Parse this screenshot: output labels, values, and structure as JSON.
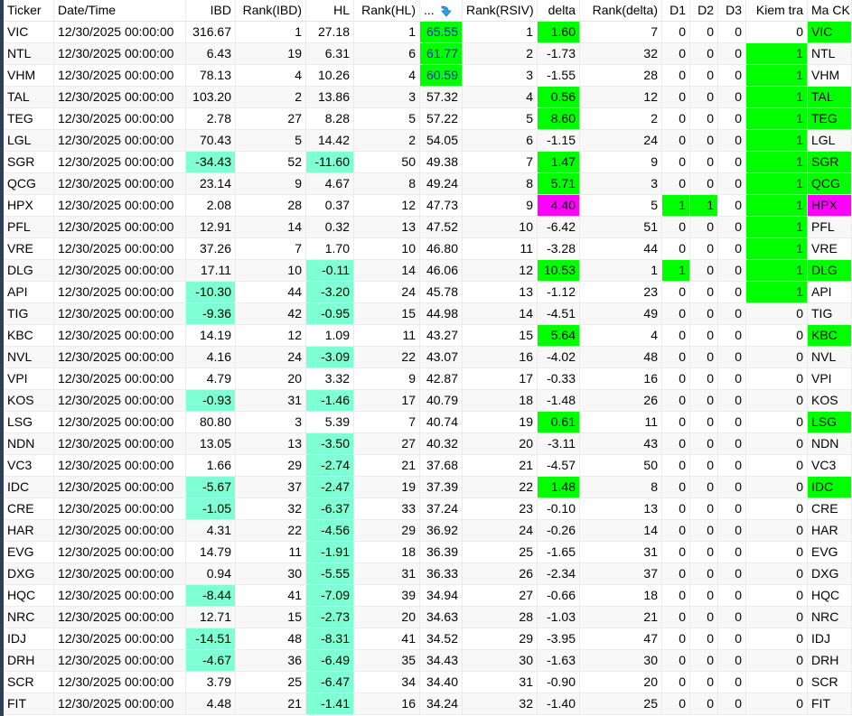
{
  "colors": {
    "green": "#00ff00",
    "aqua": "#7fffd4",
    "magenta": "#ff00ff",
    "rsiv_top_text": "#1020c0"
  },
  "columns": [
    "Ticker",
    "Date/Time",
    "IBD",
    "Rank(IBD)",
    "HL",
    "Rank(HL)",
    "...",
    "Rank(RSIV)",
    "delta",
    "Rank(delta)",
    "D1",
    "D2",
    "D3",
    "Kiem tra",
    "Ma CK"
  ],
  "sort_icon": "sort-descending-arrow-icon",
  "rows": [
    {
      "v": [
        "VIC",
        "12/30/2025 00:00:00",
        "316.67",
        "1",
        "27.18",
        "1",
        "65.55",
        "1",
        "1.60",
        "7",
        "0",
        "0",
        "0",
        "0",
        "VIC"
      ],
      "hl": {
        "6": "green",
        "8": "green",
        "14": "green"
      },
      "blue": [
        6
      ]
    },
    {
      "v": [
        "NTL",
        "12/30/2025 00:00:00",
        "6.43",
        "19",
        "6.31",
        "6",
        "61.77",
        "2",
        "-1.73",
        "32",
        "0",
        "0",
        "0",
        "1",
        "NTL"
      ],
      "hl": {
        "6": "green",
        "13": "green"
      },
      "blue": [
        6
      ]
    },
    {
      "v": [
        "VHM",
        "12/30/2025 00:00:00",
        "78.13",
        "4",
        "10.26",
        "4",
        "60.59",
        "3",
        "-1.55",
        "28",
        "0",
        "0",
        "0",
        "1",
        "VHM"
      ],
      "hl": {
        "6": "green",
        "13": "green"
      },
      "blue": [
        6
      ]
    },
    {
      "v": [
        "TAL",
        "12/30/2025 00:00:00",
        "103.20",
        "2",
        "13.86",
        "3",
        "57.32",
        "4",
        "0.56",
        "12",
        "0",
        "0",
        "0",
        "1",
        "TAL"
      ],
      "hl": {
        "8": "green",
        "13": "green",
        "14": "green"
      }
    },
    {
      "v": [
        "TEG",
        "12/30/2025 00:00:00",
        "2.78",
        "27",
        "8.28",
        "5",
        "57.22",
        "5",
        "8.60",
        "2",
        "0",
        "0",
        "0",
        "1",
        "TEG"
      ],
      "hl": {
        "8": "green",
        "13": "green",
        "14": "green"
      }
    },
    {
      "v": [
        "LGL",
        "12/30/2025 00:00:00",
        "70.43",
        "5",
        "14.42",
        "2",
        "54.05",
        "6",
        "-1.15",
        "24",
        "0",
        "0",
        "0",
        "1",
        "LGL"
      ],
      "hl": {
        "13": "green"
      }
    },
    {
      "v": [
        "SGR",
        "12/30/2025 00:00:00",
        "-34.43",
        "52",
        "-11.60",
        "50",
        "49.38",
        "7",
        "1.47",
        "9",
        "0",
        "0",
        "0",
        "1",
        "SGR"
      ],
      "hl": {
        "2": "aqua",
        "4": "aqua",
        "8": "green",
        "13": "green",
        "14": "green"
      }
    },
    {
      "v": [
        "QCG",
        "12/30/2025 00:00:00",
        "23.14",
        "9",
        "4.67",
        "8",
        "49.24",
        "8",
        "5.71",
        "3",
        "0",
        "0",
        "0",
        "1",
        "QCG"
      ],
      "hl": {
        "8": "green",
        "13": "green",
        "14": "green"
      }
    },
    {
      "v": [
        "HPX",
        "12/30/2025 00:00:00",
        "2.08",
        "28",
        "0.37",
        "12",
        "47.73",
        "9",
        "4.40",
        "5",
        "1",
        "1",
        "0",
        "1",
        "HPX"
      ],
      "hl": {
        "8": "magenta",
        "10": "green",
        "11": "green",
        "13": "green",
        "14": "magenta"
      }
    },
    {
      "v": [
        "PFL",
        "12/30/2025 00:00:00",
        "12.91",
        "14",
        "0.32",
        "13",
        "47.52",
        "10",
        "-6.42",
        "51",
        "0",
        "0",
        "0",
        "1",
        "PFL"
      ],
      "hl": {
        "13": "green"
      }
    },
    {
      "v": [
        "VRE",
        "12/30/2025 00:00:00",
        "37.26",
        "7",
        "1.70",
        "10",
        "46.80",
        "11",
        "-3.28",
        "44",
        "0",
        "0",
        "0",
        "1",
        "VRE"
      ],
      "hl": {
        "13": "green"
      }
    },
    {
      "v": [
        "DLG",
        "12/30/2025 00:00:00",
        "17.11",
        "10",
        "-0.11",
        "14",
        "46.06",
        "12",
        "10.53",
        "1",
        "1",
        "0",
        "0",
        "1",
        "DLG"
      ],
      "hl": {
        "4": "aqua",
        "8": "green",
        "10": "green",
        "13": "green",
        "14": "green"
      }
    },
    {
      "v": [
        "API",
        "12/30/2025 00:00:00",
        "-10.30",
        "44",
        "-3.20",
        "24",
        "45.78",
        "13",
        "-1.12",
        "23",
        "0",
        "0",
        "0",
        "1",
        "API"
      ],
      "hl": {
        "2": "aqua",
        "4": "aqua",
        "13": "green"
      }
    },
    {
      "v": [
        "TIG",
        "12/30/2025 00:00:00",
        "-9.36",
        "42",
        "-0.95",
        "15",
        "44.98",
        "14",
        "-4.51",
        "49",
        "0",
        "0",
        "0",
        "0",
        "TIG"
      ],
      "hl": {
        "2": "aqua",
        "4": "aqua"
      }
    },
    {
      "v": [
        "KBC",
        "12/30/2025 00:00:00",
        "14.19",
        "12",
        "1.09",
        "11",
        "43.27",
        "15",
        "5.64",
        "4",
        "0",
        "0",
        "0",
        "0",
        "KBC"
      ],
      "hl": {
        "8": "green",
        "14": "green"
      }
    },
    {
      "v": [
        "NVL",
        "12/30/2025 00:00:00",
        "4.16",
        "24",
        "-3.09",
        "22",
        "43.07",
        "16",
        "-4.02",
        "48",
        "0",
        "0",
        "0",
        "0",
        "NVL"
      ],
      "hl": {
        "4": "aqua"
      }
    },
    {
      "v": [
        "VPI",
        "12/30/2025 00:00:00",
        "4.79",
        "20",
        "3.32",
        "9",
        "42.87",
        "17",
        "-0.33",
        "16",
        "0",
        "0",
        "0",
        "0",
        "VPI"
      ],
      "hl": {}
    },
    {
      "v": [
        "KOS",
        "12/30/2025 00:00:00",
        "-0.93",
        "31",
        "-1.46",
        "17",
        "40.79",
        "18",
        "-1.48",
        "26",
        "0",
        "0",
        "0",
        "0",
        "KOS"
      ],
      "hl": {
        "2": "aqua",
        "4": "aqua"
      }
    },
    {
      "v": [
        "LSG",
        "12/30/2025 00:00:00",
        "80.80",
        "3",
        "5.39",
        "7",
        "40.74",
        "19",
        "0.61",
        "11",
        "0",
        "0",
        "0",
        "0",
        "LSG"
      ],
      "hl": {
        "8": "green",
        "14": "green"
      }
    },
    {
      "v": [
        "NDN",
        "12/30/2025 00:00:00",
        "13.05",
        "13",
        "-3.50",
        "27",
        "40.32",
        "20",
        "-3.11",
        "43",
        "0",
        "0",
        "0",
        "0",
        "NDN"
      ],
      "hl": {
        "4": "aqua"
      }
    },
    {
      "v": [
        "VC3",
        "12/30/2025 00:00:00",
        "1.66",
        "29",
        "-2.74",
        "21",
        "37.68",
        "21",
        "-4.57",
        "50",
        "0",
        "0",
        "0",
        "0",
        "VC3"
      ],
      "hl": {
        "4": "aqua"
      }
    },
    {
      "v": [
        "IDC",
        "12/30/2025 00:00:00",
        "-5.67",
        "37",
        "-2.47",
        "19",
        "37.39",
        "22",
        "1.48",
        "8",
        "0",
        "0",
        "0",
        "0",
        "IDC"
      ],
      "hl": {
        "2": "aqua",
        "4": "aqua",
        "8": "green",
        "14": "green"
      }
    },
    {
      "v": [
        "CRE",
        "12/30/2025 00:00:00",
        "-1.05",
        "32",
        "-6.37",
        "33",
        "37.24",
        "23",
        "-0.10",
        "13",
        "0",
        "0",
        "0",
        "0",
        "CRE"
      ],
      "hl": {
        "2": "aqua",
        "4": "aqua"
      }
    },
    {
      "v": [
        "HAR",
        "12/30/2025 00:00:00",
        "4.31",
        "22",
        "-4.56",
        "29",
        "36.92",
        "24",
        "-0.26",
        "14",
        "0",
        "0",
        "0",
        "0",
        "HAR"
      ],
      "hl": {
        "4": "aqua"
      }
    },
    {
      "v": [
        "EVG",
        "12/30/2025 00:00:00",
        "14.79",
        "11",
        "-1.91",
        "18",
        "36.39",
        "25",
        "-1.65",
        "31",
        "0",
        "0",
        "0",
        "0",
        "EVG"
      ],
      "hl": {
        "4": "aqua"
      }
    },
    {
      "v": [
        "DXG",
        "12/30/2025 00:00:00",
        "0.94",
        "30",
        "-5.55",
        "31",
        "36.33",
        "26",
        "-2.34",
        "37",
        "0",
        "0",
        "0",
        "0",
        "DXG"
      ],
      "hl": {
        "4": "aqua"
      }
    },
    {
      "v": [
        "HQC",
        "12/30/2025 00:00:00",
        "-8.44",
        "41",
        "-7.09",
        "39",
        "34.94",
        "27",
        "-0.66",
        "18",
        "0",
        "0",
        "0",
        "0",
        "HQC"
      ],
      "hl": {
        "2": "aqua",
        "4": "aqua"
      }
    },
    {
      "v": [
        "NRC",
        "12/30/2025 00:00:00",
        "12.71",
        "15",
        "-2.73",
        "20",
        "34.63",
        "28",
        "-1.03",
        "21",
        "0",
        "0",
        "0",
        "0",
        "NRC"
      ],
      "hl": {
        "4": "aqua"
      }
    },
    {
      "v": [
        "IDJ",
        "12/30/2025 00:00:00",
        "-14.51",
        "48",
        "-8.31",
        "41",
        "34.52",
        "29",
        "-3.95",
        "47",
        "0",
        "0",
        "0",
        "0",
        "IDJ"
      ],
      "hl": {
        "2": "aqua",
        "4": "aqua"
      }
    },
    {
      "v": [
        "DRH",
        "12/30/2025 00:00:00",
        "-4.67",
        "36",
        "-6.49",
        "35",
        "34.43",
        "30",
        "-1.63",
        "30",
        "0",
        "0",
        "0",
        "0",
        "DRH"
      ],
      "hl": {
        "2": "aqua",
        "4": "aqua"
      }
    },
    {
      "v": [
        "SCR",
        "12/30/2025 00:00:00",
        "3.79",
        "25",
        "-6.47",
        "34",
        "34.40",
        "31",
        "-0.90",
        "20",
        "0",
        "0",
        "0",
        "0",
        "SCR"
      ],
      "hl": {
        "4": "aqua"
      }
    },
    {
      "v": [
        "FIT",
        "12/30/2025 00:00:00",
        "4.48",
        "21",
        "-1.41",
        "16",
        "34.24",
        "32",
        "-1.40",
        "25",
        "0",
        "0",
        "0",
        "0",
        "FIT"
      ],
      "hl": {
        "4": "aqua"
      }
    }
  ]
}
